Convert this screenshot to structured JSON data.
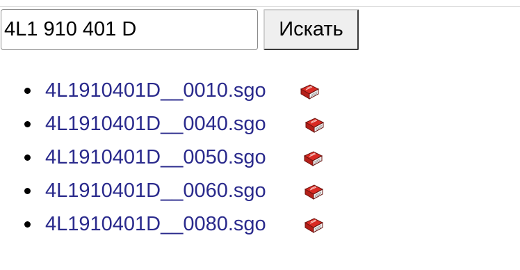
{
  "search": {
    "value": "4L1 910 401 D",
    "button_label": "Искать"
  },
  "results": [
    {
      "filename": "4L1910401D__0010.sgo",
      "icon": "red-book-icon"
    },
    {
      "filename": "4L1910401D__0040.sgo",
      "icon": "red-book-icon"
    },
    {
      "filename": "4L1910401D__0050.sgo",
      "icon": "red-book-icon"
    },
    {
      "filename": "4L1910401D__0060.sgo",
      "icon": "red-book-icon"
    },
    {
      "filename": "4L1910401D__0080.sgo",
      "icon": "red-book-icon"
    }
  ],
  "colors": {
    "link": "#2a2a8c",
    "book": "#d92a23"
  }
}
